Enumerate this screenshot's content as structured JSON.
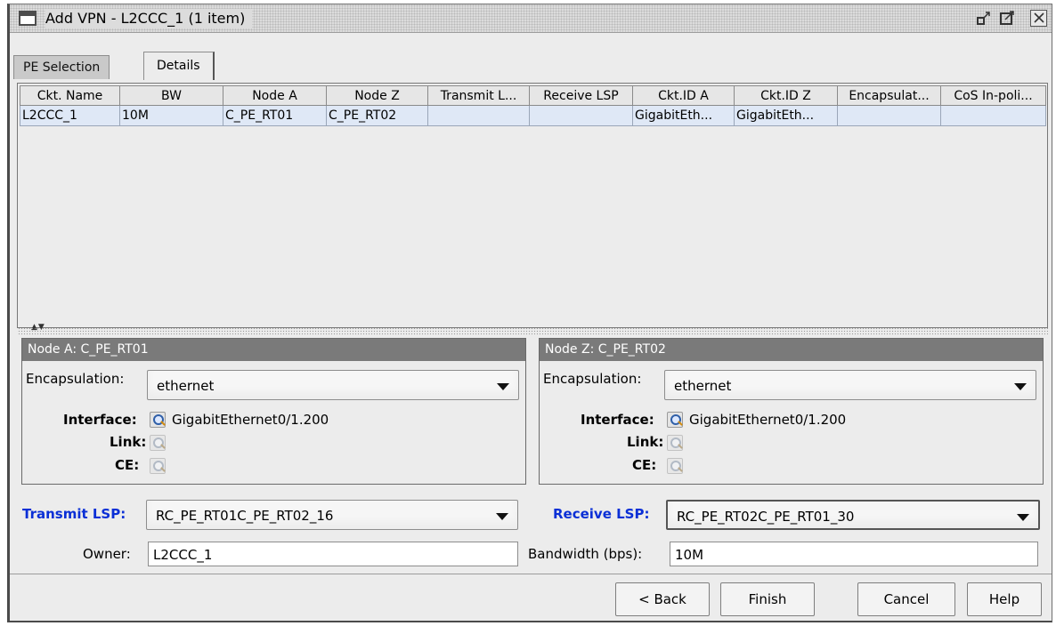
{
  "window": {
    "title": "Add VPN - L2CCC_1 (1 item)",
    "controls": {
      "minimize": "▫",
      "maximize": "◳",
      "close": "✕"
    }
  },
  "tabs": [
    {
      "label": "PE Selection",
      "selected": false
    },
    {
      "label": "Details",
      "selected": true
    }
  ],
  "table": {
    "columns": [
      "Ckt. Name",
      "BW",
      "Node A",
      "Node Z",
      "Transmit L...",
      "Receive LSP",
      "Ckt.ID A",
      "Ckt.ID Z",
      "Encapsulat...",
      "CoS In-poli..."
    ],
    "rows": [
      [
        "L2CCC_1",
        "10M",
        "C_PE_RT01",
        "C_PE_RT02",
        "",
        "",
        "GigabitEth...",
        "GigabitEth...",
        "",
        ""
      ]
    ]
  },
  "node_a": {
    "header": "Node A: C_PE_RT01",
    "encapsulation_label": "Encapsulation:",
    "encapsulation_value": "ethernet",
    "interface_label": "Interface:",
    "interface_value": "GigabitEthernet0/1.200",
    "link_label": "Link:",
    "ce_label": "CE:"
  },
  "node_z": {
    "header": "Node Z: C_PE_RT02",
    "encapsulation_label": "Encapsulation:",
    "encapsulation_value": "ethernet",
    "interface_label": "Interface:",
    "interface_value": "GigabitEthernet0/1.200",
    "link_label": "Link:",
    "ce_label": "CE:"
  },
  "lsp": {
    "transmit_label": "Transmit LSP:",
    "transmit_value": "RC_PE_RT01C_PE_RT02_16",
    "receive_label": "Receive LSP:",
    "receive_value": "RC_PE_RT02C_PE_RT01_30",
    "owner_label": "Owner:",
    "owner_value": "L2CCC_1",
    "bandwidth_label": "Bandwidth (bps):",
    "bandwidth_value": "10M"
  },
  "buttons": {
    "back": "< Back",
    "finish": "Finish",
    "cancel": "Cancel",
    "help": "Help"
  },
  "colors": {
    "selected_row": "#dfe8f6",
    "panel_header": "#7a7a7a",
    "lsp_label": "#0a2fd6"
  }
}
